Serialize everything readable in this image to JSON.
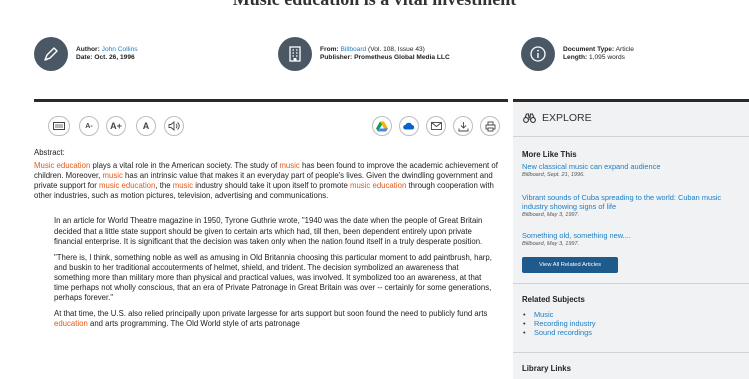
{
  "page": {
    "title": "Music education is a vital investment"
  },
  "meta": {
    "author": {
      "label": "Author:",
      "value": "John Collins",
      "date_label": "Date:",
      "date": "Oct. 26, 1996"
    },
    "source": {
      "label": "From:",
      "value": "Billboard",
      "issue": "(Vol. 108, Issue 43)",
      "publisher_label": "Publisher:",
      "publisher": "Prometheus Global Media LLC"
    },
    "doc": {
      "type_label": "Document Type:",
      "type": "Article",
      "length_label": "Length:",
      "length": "1,095 words"
    }
  },
  "toolbar": {
    "font_smaller": "A-",
    "font_larger": "A+",
    "contrast": "A",
    "icons": [
      "dictionary-icon",
      "font-decrease-icon",
      "font-increase-icon",
      "font-contrast-icon",
      "listen-icon",
      "google-drive-icon",
      "onedrive-icon",
      "email-icon",
      "download-icon",
      "print-icon"
    ]
  },
  "article": {
    "abstract_label": "Abstract:",
    "abstract_parts": [
      {
        "t": "Music education",
        "h": true
      },
      {
        "t": " plays a vital role in the American society. The study of ",
        "h": false
      },
      {
        "t": "music",
        "h": true
      },
      {
        "t": " has been found to improve the academic achievement of children. Moreover, ",
        "h": false
      },
      {
        "t": "music",
        "h": true
      },
      {
        "t": " has an intrinsic value that makes it an everyday part of people's lives. Given the dwindling government and private support for ",
        "h": false
      },
      {
        "t": "music education",
        "h": true
      },
      {
        "t": ", the ",
        "h": false
      },
      {
        "t": "music",
        "h": true
      },
      {
        "t": " industry should take it upon itself to promote ",
        "h": false
      },
      {
        "t": "music education",
        "h": true
      },
      {
        "t": " through cooperation with other industries, such as motion pictures, television, advertising and communications.",
        "h": false
      }
    ],
    "para1": "In an article for World Theatre magazine in 1950, Tyrone Guthrie wrote, \"1940 was the date when the people of Great Britain decided that a little state support should be given to certain arts which had, till then, been dependent entirely upon private financial enterprise. It is significant that the decision was taken only when the nation found itself in a truly desperate position.",
    "para2": "\"There is, I think, something noble as well as amusing in Old Britannia choosing this particular moment to add paintbrush, harp, and buskin to her traditional accouterments of helmet, shield, and trident. The decision symbolized an awareness that something more than military more than physical and practical values, was involved. It symbolized too an awareness, at that time perhaps not wholly conscious, that an era of Private Patronage in Great Britain was over -- certainly for some generations, perhaps forever.\"",
    "para3_parts": [
      {
        "t": "At that time, the U.S. also relied principally upon private largesse for arts support but soon found the need to publicly fund arts ",
        "h": false
      },
      {
        "t": "education",
        "h": true
      },
      {
        "t": " and arts programming. The Old World style of arts patronage",
        "h": false
      }
    ]
  },
  "sidebar": {
    "explore": "EXPLORE",
    "more_like_this": "More Like This",
    "related": [
      {
        "title": "New classical music can expand audience",
        "source": "Billboard, Sept. 21, 1996."
      },
      {
        "title": "Vibrant sounds of Cuba spreading to the world: Cuban music industry showing signs of life",
        "source": "Billboard, May 3, 1997."
      },
      {
        "title": "Something old, something new....",
        "source": "Billboard, May 3, 1997."
      }
    ],
    "view_all": "View All Related Articles",
    "related_subjects": "Related Subjects",
    "subjects": [
      "Music",
      "Recording industry",
      "Sound recordings"
    ],
    "library_links": "Library Links"
  },
  "colors": {
    "accent_link": "#1a7fc4",
    "highlight": "#e35a1c",
    "button": "#1e5a8c",
    "icon_circle": "#4a5866"
  }
}
